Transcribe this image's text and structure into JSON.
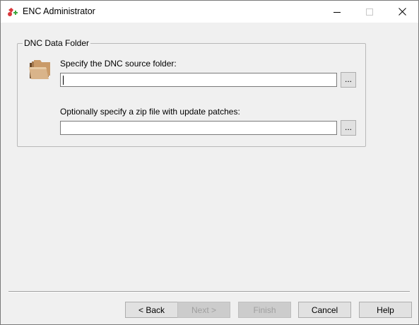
{
  "window": {
    "title": "ENC Administrator"
  },
  "titlebar_buttons": {
    "minimize": "minimize-icon",
    "maximize": "maximize-icon",
    "close": "close-icon"
  },
  "group": {
    "label": "DNC Data Folder",
    "icon": "folder-icon",
    "source_label": "Specify the DNC source folder:",
    "source_value": "",
    "zip_label": "Optionally specify a zip file with update patches:",
    "zip_value": "",
    "browse_label": "..."
  },
  "buttons": {
    "back": "< Back",
    "next": "Next >",
    "finish": "Finish",
    "cancel": "Cancel",
    "help": "Help"
  },
  "colors": {
    "background": "#f0f0f0",
    "button_face": "#e1e1e1",
    "disabled_text": "#a0a0a0"
  }
}
